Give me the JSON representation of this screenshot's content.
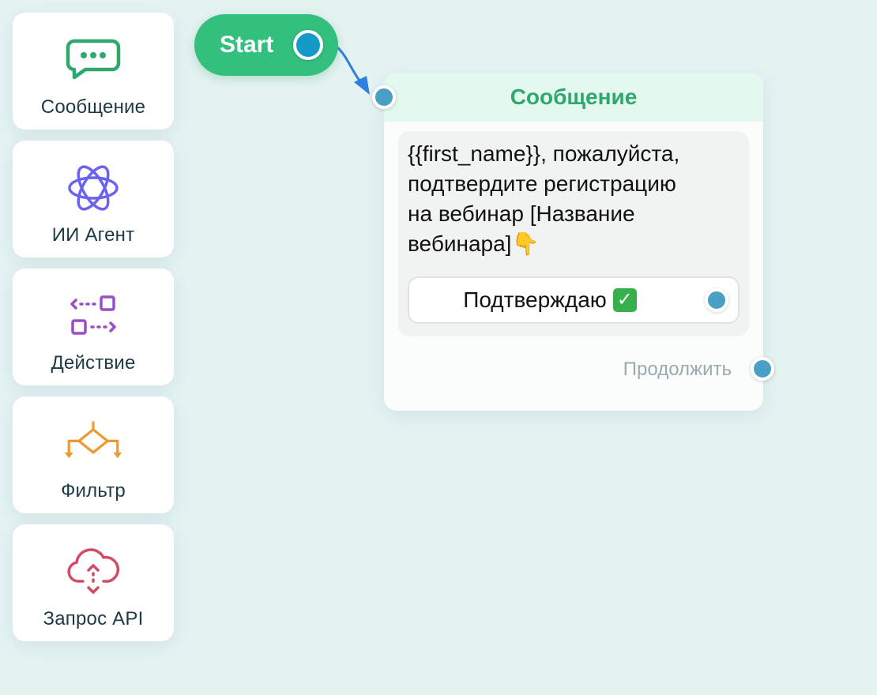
{
  "palette": {
    "items": [
      {
        "label": "Сообщение",
        "icon": "chat-bubble-icon",
        "color": "#2fa86f"
      },
      {
        "label": "ИИ Агент",
        "icon": "atom-icon",
        "color": "#6a63f0"
      },
      {
        "label": "Действие",
        "icon": "action-arrows-icon",
        "color": "#9b4fc2"
      },
      {
        "label": "Фильтр",
        "icon": "filter-branch-icon",
        "color": "#f0982e"
      },
      {
        "label": "Запрос API",
        "icon": "cloud-api-icon",
        "color": "#d04c68"
      }
    ]
  },
  "canvas": {
    "start_node": {
      "label": "Start",
      "color": "#33c07f"
    },
    "message_node": {
      "title": "Сообщение",
      "text": "{{first_name}}, пожалуйста,\nподтвердите регистрацию\nна вебинар [Название\nвебинара]👇",
      "button_label": "Подтверждаю",
      "button_icon": "check-mark-icon",
      "continue_label": "Продолжить"
    },
    "connector_color": "#2f7fe0"
  }
}
